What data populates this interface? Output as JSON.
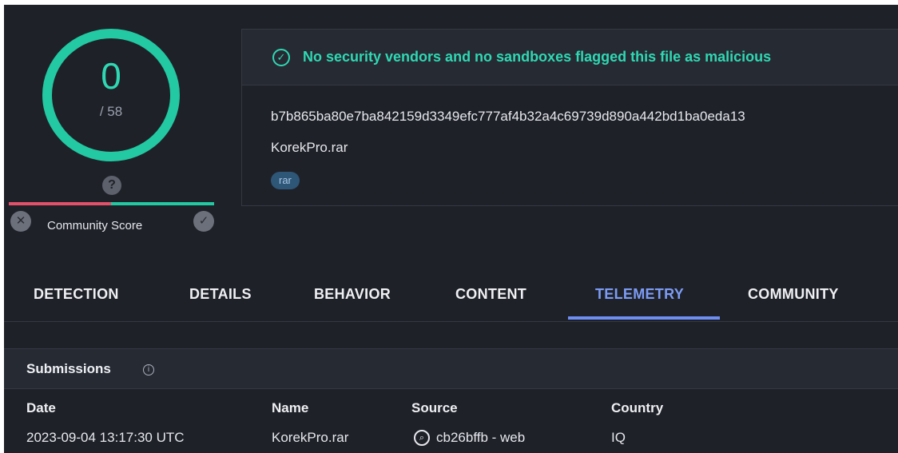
{
  "score": {
    "value": "0",
    "total": "/ 58"
  },
  "community": {
    "label": "Community Score",
    "unknown_icon": "question-icon"
  },
  "file": {
    "status": "No security vendors and no sandboxes flagged this file as malicious",
    "hash": "b7b865ba80e7ba842159d3349efc777af4b32a4c69739d890a442bd1ba0eda13",
    "name": "KorekPro.rar",
    "tag": "rar"
  },
  "tabs": [
    {
      "label": "DETECTION"
    },
    {
      "label": "DETAILS"
    },
    {
      "label": "BEHAVIOR"
    },
    {
      "label": "CONTENT"
    },
    {
      "label": "TELEMETRY",
      "active": true
    },
    {
      "label": "COMMUNITY"
    }
  ],
  "submissions": {
    "title": "Submissions",
    "columns": [
      "Date",
      "Name",
      "Source",
      "Country"
    ],
    "rows": [
      [
        "2023-09-04 13:17:30 UTC",
        "KorekPro.rar",
        "cb26bffb - web",
        "IQ"
      ]
    ]
  },
  "colors": {
    "background": "#1f2128",
    "accent_green": "#22c9a2",
    "accent_red": "#e2506a",
    "active_tab": "#7c9cf5"
  }
}
